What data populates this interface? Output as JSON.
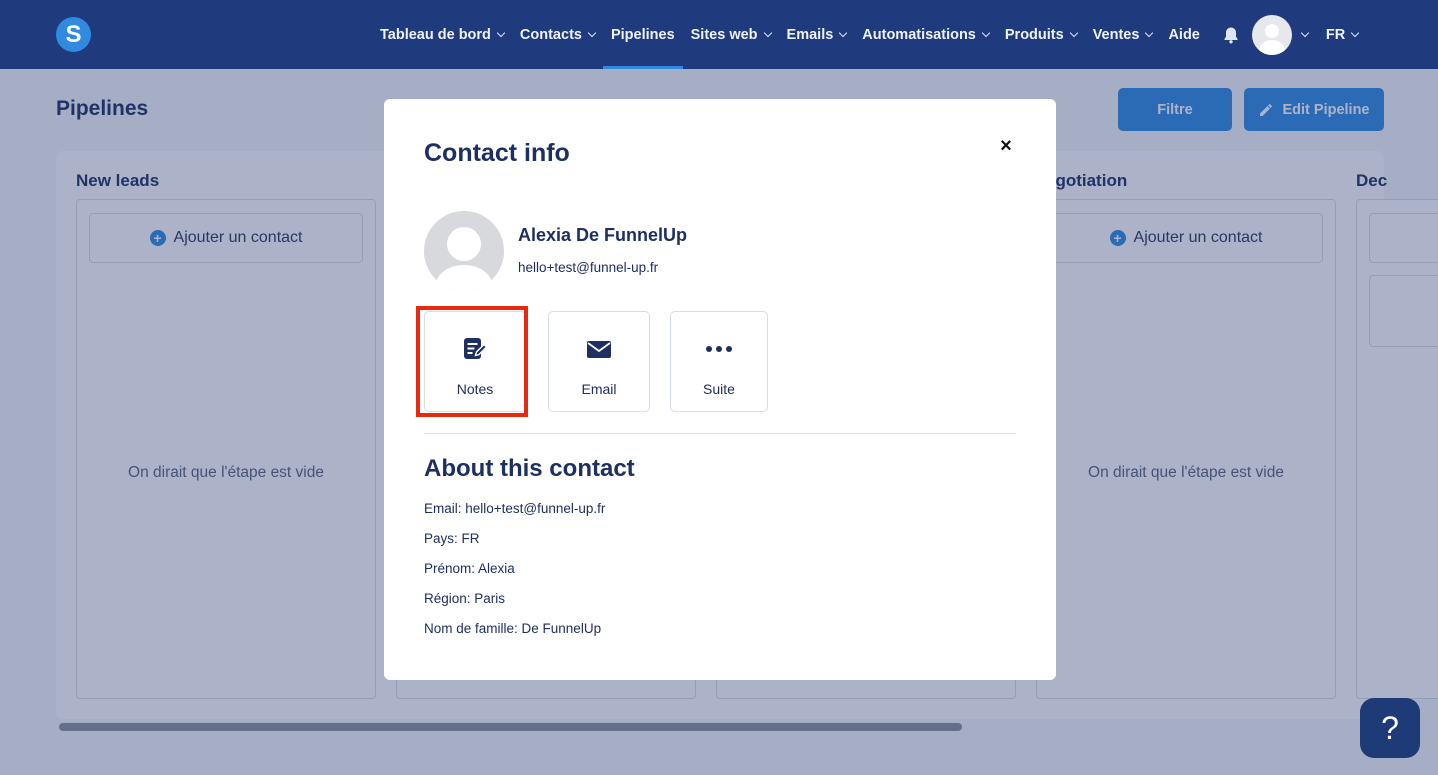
{
  "nav": {
    "items": [
      {
        "label": "Tableau de bord",
        "dropdown": true,
        "active": false
      },
      {
        "label": "Contacts",
        "dropdown": true,
        "active": false
      },
      {
        "label": "Pipelines",
        "dropdown": false,
        "active": true
      },
      {
        "label": "Sites web",
        "dropdown": true,
        "active": false
      },
      {
        "label": "Emails",
        "dropdown": true,
        "active": false
      },
      {
        "label": "Automatisations",
        "dropdown": true,
        "active": false
      },
      {
        "label": "Produits",
        "dropdown": true,
        "active": false
      },
      {
        "label": "Ventes",
        "dropdown": true,
        "active": false
      },
      {
        "label": "Aide",
        "dropdown": false,
        "active": false
      }
    ],
    "logo_letter": "S",
    "language": "FR"
  },
  "page": {
    "title": "Pipelines",
    "filter_label": "Filtre",
    "edit_label": "Edit Pipeline"
  },
  "board": {
    "columns": [
      {
        "title": "New leads",
        "add_label": "Ajouter un contact",
        "empty_text": "On dirait que l'étape est vide"
      },
      {
        "title": "egotiation",
        "add_label": "Ajouter un contact",
        "empty_text": "On dirait que l'étape est vide"
      },
      {
        "title": "Dec"
      }
    ]
  },
  "modal": {
    "title": "Contact info",
    "close_glyph": "×",
    "contact_name": "Alexia De FunnelUp",
    "contact_email": "hello+test@funnel-up.fr",
    "actions": [
      {
        "label": "Notes",
        "icon": "notes-icon"
      },
      {
        "label": "Email",
        "icon": "envelope-icon"
      },
      {
        "label": "Suite",
        "icon": "more-icon"
      }
    ],
    "about_title": "About this contact",
    "fields": [
      "Email: hello+test@funnel-up.fr",
      "Pays: FR",
      "Prénom: Alexia",
      "Région: Paris",
      "Nom de famille: De FunnelUp"
    ]
  },
  "help_glyph": "?",
  "colors": {
    "navbar": "#1f3a7d",
    "accent": "#2f8ae0",
    "text": "#1e2f62",
    "highlight": "#e8280f"
  }
}
